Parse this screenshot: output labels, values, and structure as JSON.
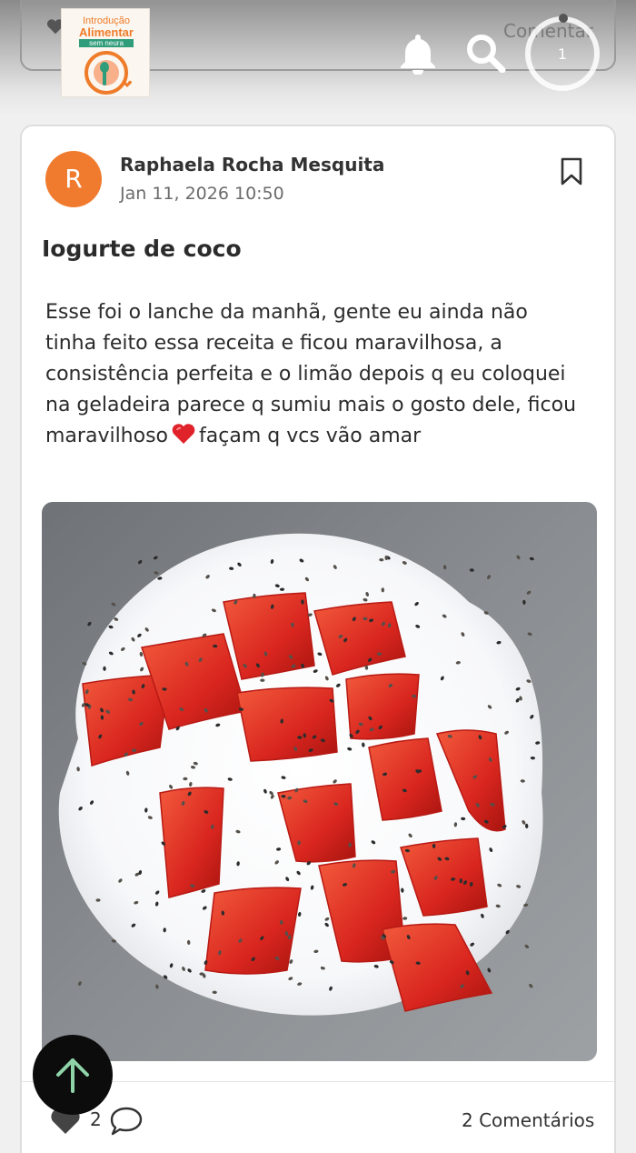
{
  "header": {
    "logo": {
      "line1": "Introdução",
      "line2": "Alimentar",
      "line3": "sem neura"
    },
    "ghost_label": "Comentar",
    "progress_value": "1",
    "icons": [
      "bell-icon",
      "search-icon"
    ]
  },
  "post": {
    "author_initial": "R",
    "author": "Raphaela Rocha Mesquita",
    "date": "Jan 11, 2026 10:50",
    "title": "Iogurte de coco",
    "body_before_emoji": "Esse foi o lanche da manhã, gente eu ainda não tinha feito essa receita e ficou maravilhosa, a consistência perfeita e o limão depois q eu coloquei na geladeira parece q sumiu mais o gosto dele, ficou maravilhoso",
    "body_after_emoji": "façam q vcs vão amar",
    "likes": "2",
    "comments_label": "2 Comentários"
  },
  "colors": {
    "avatar": "#f07b2f",
    "scroll_button": "#0c0c0c",
    "scroll_arrow": "#8fd4a8"
  }
}
